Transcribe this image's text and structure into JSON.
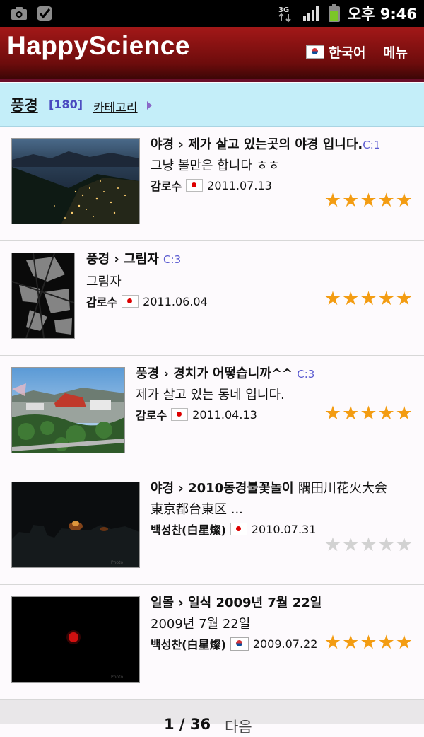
{
  "status": {
    "time": "오후 9:46",
    "network": "3G"
  },
  "app": {
    "title": "HappyScience",
    "language": "한국어",
    "menu": "메뉴"
  },
  "category": {
    "title": "풍경",
    "count": "[180]",
    "link": "카테고리"
  },
  "items": [
    {
      "category": "야경",
      "title": "제가 살고 있는곳의 야경 입니다.",
      "comments": "C:1",
      "description": "그냥 볼만은 합니다 ㅎㅎ",
      "author": "감로수",
      "country": "jp",
      "date": "2011.07.13",
      "rating": 5
    },
    {
      "category": "풍경",
      "title": "그림자",
      "comments": "C:3",
      "description": "그림자",
      "author": "감로수",
      "country": "jp",
      "date": "2011.06.04",
      "rating": 5
    },
    {
      "category": "풍경",
      "title": "경치가 어떻습니까^^",
      "comments": "C:3",
      "description": "제가 살고 있는 동네 입니다.",
      "author": "감로수",
      "country": "jp",
      "date": "2011.04.13",
      "rating": 5
    },
    {
      "category": "야경",
      "title": "2010동경불꽃놀이",
      "title_extra": "隅田川花火大会",
      "comments": "",
      "description": "東京都台東区 ...",
      "author": "백성찬(白星燦)",
      "country": "jp",
      "date": "2010.07.31",
      "rating": 0
    },
    {
      "category": "일몰",
      "title": "일식 2009년 7월 22일",
      "comments": "",
      "description": "2009년 7월 22일",
      "author": "백성찬(白星燦)",
      "country": "kr",
      "date": "2009.07.22",
      "rating": 5
    }
  ],
  "pager": {
    "page": "1 / 36",
    "next": "다음"
  },
  "colors": {
    "appbar": "#8b1010",
    "category_bar": "#c4eef9",
    "star_on": "#f39c12",
    "star_off": "#d2d2d2",
    "comment_badge": "#5a5ad0"
  }
}
